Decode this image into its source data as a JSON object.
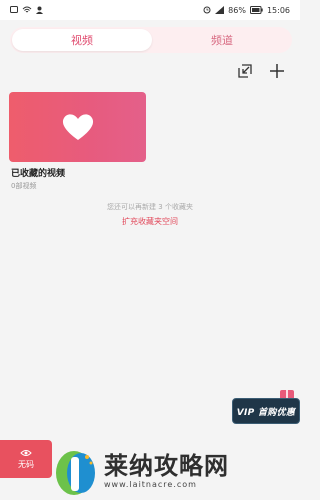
{
  "status_bar": {
    "battery": "86%",
    "time": "15:06",
    "icons": [
      "message-icon",
      "wifi-icon",
      "person-icon",
      "alarm-icon",
      "signal-icon",
      "battery-icon"
    ]
  },
  "tabs": [
    {
      "label": "视频",
      "active": true
    },
    {
      "label": "频道",
      "active": false
    }
  ],
  "toolbar": {
    "import_icon": "import-icon",
    "add_icon": "plus-icon"
  },
  "collection": {
    "title": "已收藏的视频",
    "count": "0部视频",
    "icon": "heart-icon",
    "gradient": [
      "#ee5d6c",
      "#e4608a"
    ]
  },
  "hint": "您还可以再新建 3 个收藏夹",
  "expand_link": "扩充收藏夹空间",
  "vip": {
    "label": "VIP 首购优惠",
    "icon": "gift-icon"
  },
  "nocode_button": {
    "label": "无码",
    "icon": "eye-icon"
  },
  "watermark": {
    "title": "莱纳攻略网",
    "url": "www.laitnacre.com"
  },
  "colors": {
    "accent": "#e24a5c",
    "tab_bg": "#fdeef0",
    "vip_bg": "#1f3648"
  }
}
